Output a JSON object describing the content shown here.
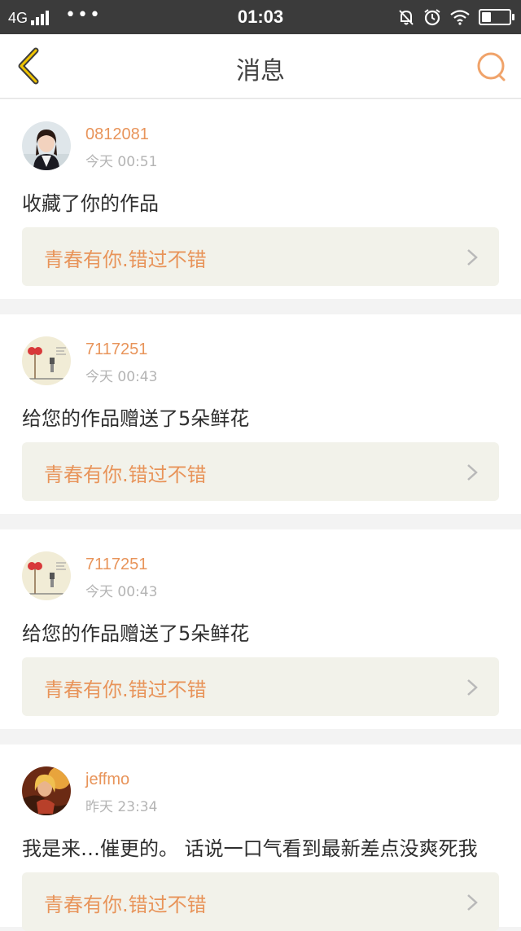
{
  "status_bar": {
    "network": "4G",
    "dots": "•••",
    "time": "01:03",
    "battery_level": 0.35
  },
  "header": {
    "title": "消息",
    "back_icon": "chevron-left-icon",
    "search_icon": "search-icon",
    "accent_color": "#e8945a"
  },
  "messages": [
    {
      "username": "0812081",
      "time": "今天 00:51",
      "text": "收藏了你的作品",
      "work_title": "青春有你.错过不错"
    },
    {
      "username": "7117251",
      "time": "今天 00:43",
      "text": "给您的作品赠送了5朵鲜花",
      "work_title": "青春有你.错过不错"
    },
    {
      "username": "7117251",
      "time": "今天 00:43",
      "text": "给您的作品赠送了5朵鲜花",
      "work_title": "青春有你.错过不错"
    },
    {
      "username": "jeffmo",
      "time": "昨天 23:34",
      "text": "我是来…催更的。 话说一口气看到最新差点没爽死我",
      "work_title": "青春有你.错过不错"
    }
  ]
}
